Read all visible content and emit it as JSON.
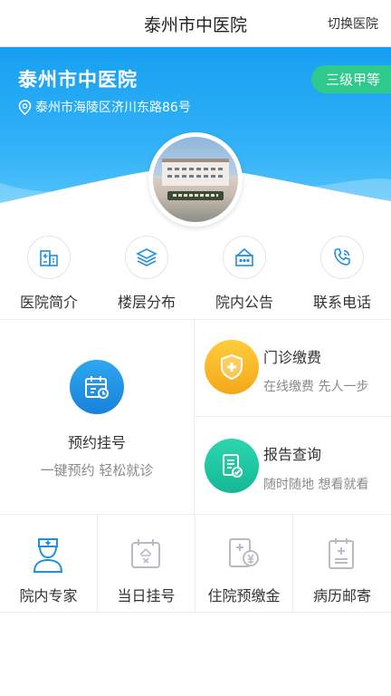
{
  "header": {
    "title": "泰州市中医院",
    "switch_label": "切换医院"
  },
  "hospital": {
    "name": "泰州市中医院",
    "address": "泰州市海陵区济川东路86号",
    "level": "三级甲等"
  },
  "quick_links": [
    {
      "label": "医院简介",
      "icon": "hospital-building-icon"
    },
    {
      "label": "楼层分布",
      "icon": "layers-icon"
    },
    {
      "label": "院内公告",
      "icon": "notice-house-icon"
    },
    {
      "label": "联系电话",
      "icon": "phone-icon"
    }
  ],
  "main": {
    "appointment": {
      "title": "预约挂号",
      "subtitle": "一键预约 轻松就诊",
      "icon": "calendar-icon"
    },
    "payment": {
      "title": "门诊缴费",
      "subtitle": "在线缴费 先人一步",
      "icon": "payment-shield-icon"
    },
    "report": {
      "title": "报告查询",
      "subtitle": "随时随地 想看就看",
      "icon": "report-document-icon"
    }
  },
  "bottom_links": [
    {
      "label": "院内专家",
      "icon": "nurse-icon"
    },
    {
      "label": "当日挂号",
      "icon": "today-calendar-icon"
    },
    {
      "label": "住院预缴金",
      "icon": "deposit-document-icon"
    },
    {
      "label": "病历邮寄",
      "icon": "medical-record-icon"
    }
  ],
  "colors": {
    "primary": "#1a9ff0",
    "level_badge": "#2ec98b",
    "payment": "#f8b72a",
    "report": "#17c59f"
  }
}
